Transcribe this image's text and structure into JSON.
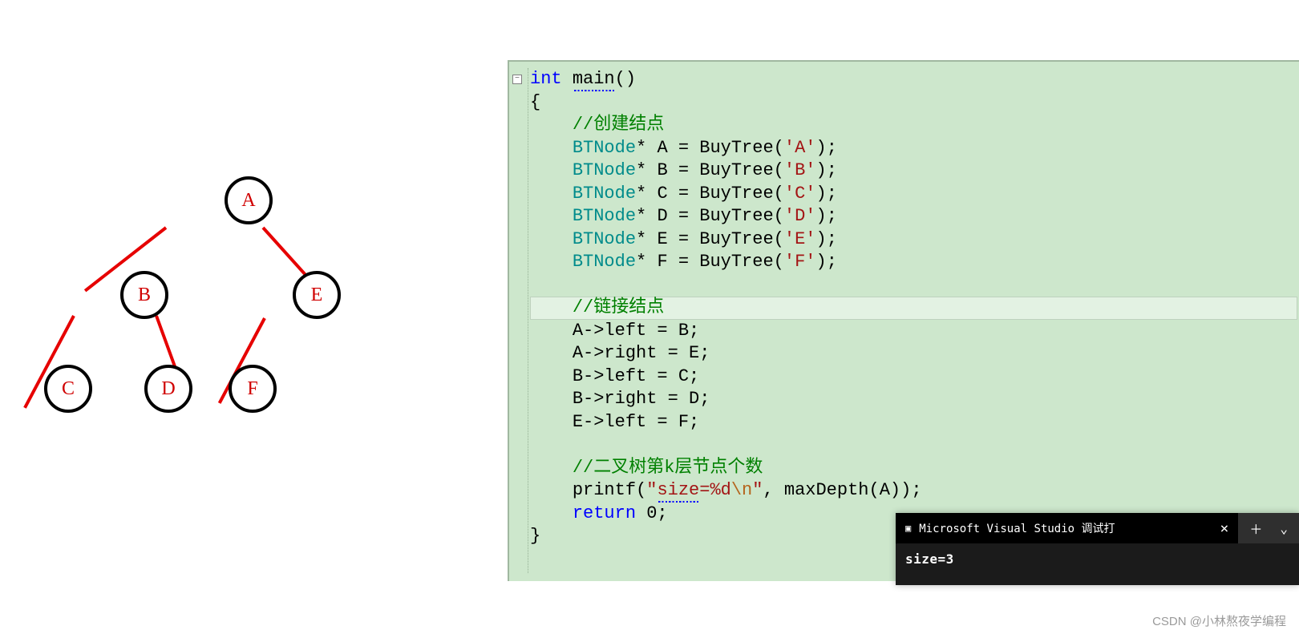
{
  "tree": {
    "nodes": {
      "a": "A",
      "b": "B",
      "c": "C",
      "d": "D",
      "e": "E",
      "f": "F"
    }
  },
  "code": {
    "kw_int": "int",
    "fn_main": "main",
    "parens": "()",
    "lbrace": "{",
    "rbrace": "}",
    "comment_create": "//创建结点",
    "type_btnode": "BTNode",
    "star": "* ",
    "eq": " = ",
    "fn_buy": "BuyTree",
    "decl_a": "A",
    "param_a": "'A'",
    "decl_b": "B",
    "param_b": "'B'",
    "decl_c": "C",
    "param_c": "'C'",
    "decl_d": "D",
    "param_d": "'D'",
    "decl_e": "E",
    "param_e": "'E'",
    "decl_f": "F",
    "param_f": "'F'",
    "tail": ";",
    "open": "(",
    "close": ")",
    "comment_link": "//链接结点",
    "link_1": "A->left = B;",
    "link_2": "A->right = E;",
    "link_3": "B->left = C;",
    "link_4": "B->right = D;",
    "link_5": "E->left = F;",
    "comment_k": "//二叉树第k层节点个数",
    "printf": "printf",
    "fmt_open": "\"",
    "fmt_size": "size",
    "fmt_eq": "=%d",
    "fmt_esc": "\\n",
    "fmt_close": "\"",
    "comma": ",",
    "call_depth": " maxDepth(A))",
    "kw_return": "return",
    "zero": " 0;"
  },
  "terminal": {
    "title": "Microsoft Visual Studio 调试打",
    "close": "×",
    "plus": "＋",
    "chev": "⌄",
    "output": "size=3"
  },
  "watermark": "CSDN @小林熬夜学编程"
}
